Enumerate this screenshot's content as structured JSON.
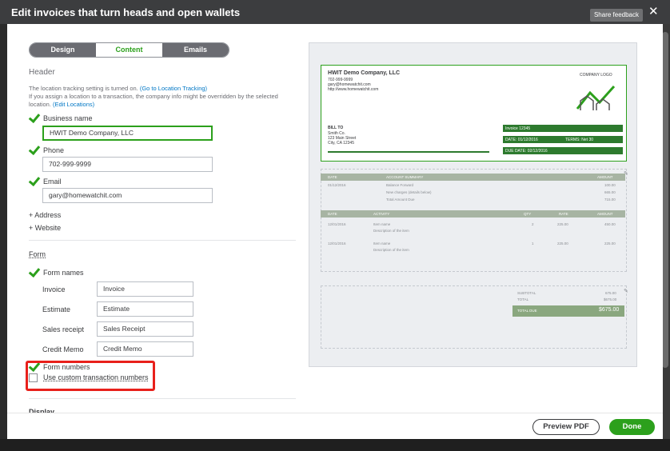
{
  "window": {
    "title": "Edit invoices that turn heads and open wallets",
    "share_feedback": "Share feedback",
    "close": "✕"
  },
  "tabs": [
    {
      "label": "Design"
    },
    {
      "label": "Content"
    },
    {
      "label": "Emails"
    }
  ],
  "header": {
    "heading": "Header",
    "notice_1": "The location tracking setting is turned on.",
    "notice_link": "(Go to Location Tracking)",
    "notice_2": "If you assign a location to a transaction, the company info might be overridden by the selected location.",
    "notice_link2": "(Edit Locations)",
    "business_name_label": "Business name",
    "business_name_value": "HWIT Demo Company, LLC",
    "phone_label": "Phone",
    "phone_value": "702-999-9999",
    "email_label": "Email",
    "email_value": "gary@homewatchit.com",
    "add_address": "+ Address",
    "add_website": "+ Website"
  },
  "form": {
    "heading": "Form",
    "form_names_label": "Form names",
    "names": [
      {
        "label": "Invoice",
        "value": "Invoice"
      },
      {
        "label": "Estimate",
        "value": "Estimate"
      },
      {
        "label": "Sales receipt",
        "value": "Sales Receipt"
      },
      {
        "label": "Credit Memo",
        "value": "Credit Memo"
      }
    ],
    "form_numbers_label": "Form numbers",
    "custom_numbers_label": "Use custom transaction numbers"
  },
  "next_section": "Display",
  "preview": {
    "company": "HWIT Demo Company, LLC",
    "phone": "702-999-9999",
    "email": "gary@homewatchit.com",
    "web": "http://www.homewatchit.com",
    "logo_label": "COMPANY LOGO",
    "bill_to": "BILL TO",
    "client": "Smith Co.",
    "addr1": "123 Main Street",
    "addr2": "City, CA 12345",
    "invoice_no": "Invoice  12345",
    "date": "DATE: 01/12/2016",
    "terms": "TERMS: Net 30",
    "due": "DUE DATE: 02/12/2016",
    "summary_head": [
      "DATE",
      "ACCOUNT SUMMARY",
      "AMOUNT"
    ],
    "summary_rows": [
      [
        "01/12/2016",
        "Balance Forward",
        "100.00"
      ],
      [
        "",
        "New charges (details below)",
        "665.00"
      ],
      [
        "",
        "Total Amount Due",
        "715.00"
      ]
    ],
    "activity_head": [
      "DATE",
      "ACTIVITY",
      "QTY",
      "RATE",
      "AMOUNT"
    ],
    "activity_rows": [
      [
        "12/01/2016",
        "Item name",
        "Description of the item",
        "2",
        "225.00",
        "450.00"
      ],
      [
        "12/01/2016",
        "Item name",
        "Description of the item",
        "1",
        "225.00",
        "225.00"
      ]
    ],
    "subtotal_label": "SUBTOTAL",
    "subtotal": "675.00",
    "total_label": "TOTAL",
    "total": "$675.00",
    "due_label": "TOTAL DUE",
    "due_value": "$675.00"
  },
  "footer": {
    "preview_pdf": "Preview PDF",
    "done": "Done"
  }
}
